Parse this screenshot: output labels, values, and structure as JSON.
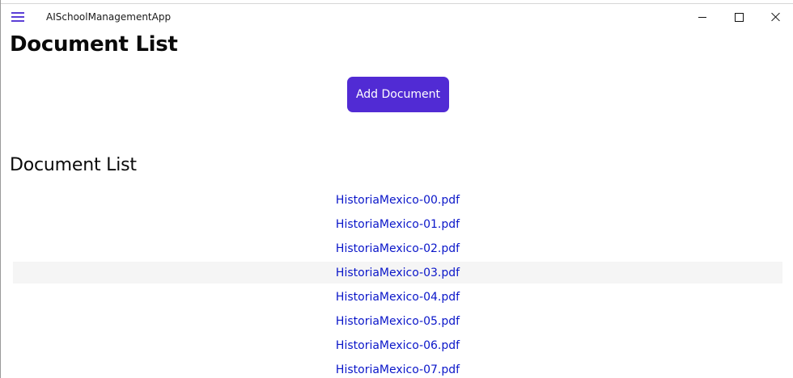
{
  "window": {
    "app_title": "AISchoolManagementApp"
  },
  "page": {
    "title": "Document List",
    "add_button_label": "Add Document",
    "section_title": "Document List"
  },
  "documents": [
    "HistoriaMexico-00.pdf",
    "HistoriaMexico-01.pdf",
    "HistoriaMexico-02.pdf",
    "HistoriaMexico-03.pdf",
    "HistoriaMexico-04.pdf",
    "HistoriaMexico-05.pdf",
    "HistoriaMexico-06.pdf",
    "HistoriaMexico-07.pdf"
  ],
  "hovered_index": 3,
  "colors": {
    "accent": "#512bd4",
    "link": "#0a16c9",
    "hover_row": "#f5f5f5"
  },
  "icons": {
    "menu": "hamburger-icon",
    "minimize": "minimize-icon",
    "maximize": "maximize-icon",
    "close": "close-icon"
  }
}
